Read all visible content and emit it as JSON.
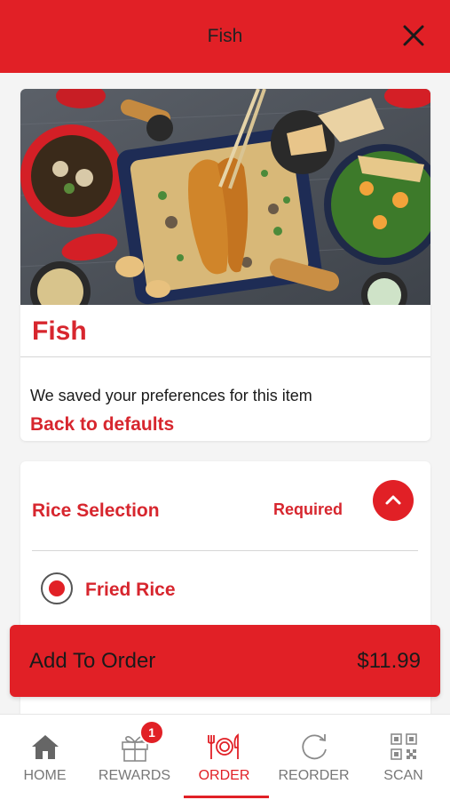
{
  "header": {
    "title": "Fish",
    "close_icon": "close-icon"
  },
  "item": {
    "title": "Fish",
    "saved_text": "We saved your preferences for this item",
    "back_to_defaults": "Back to defaults"
  },
  "options": {
    "section_title": "Rice Selection",
    "required_label": "Required",
    "collapse_icon": "chevron-up-icon",
    "choices": [
      {
        "label": "Fried Rice",
        "selected": true
      }
    ]
  },
  "add_to_order": {
    "label": "Add To Order",
    "price": "$11.99"
  },
  "tabbar": {
    "tabs": [
      {
        "label": "HOME",
        "icon": "home-icon"
      },
      {
        "label": "REWARDS",
        "icon": "gift-icon",
        "badge": "1"
      },
      {
        "label": "ORDER",
        "icon": "utensils-icon",
        "active": true
      },
      {
        "label": "REORDER",
        "icon": "reorder-icon"
      },
      {
        "label": "SCAN",
        "icon": "qr-code-icon"
      }
    ]
  },
  "colors": {
    "brand": "#e12026",
    "text_red": "#d7262e",
    "tab_inactive": "#777777"
  }
}
